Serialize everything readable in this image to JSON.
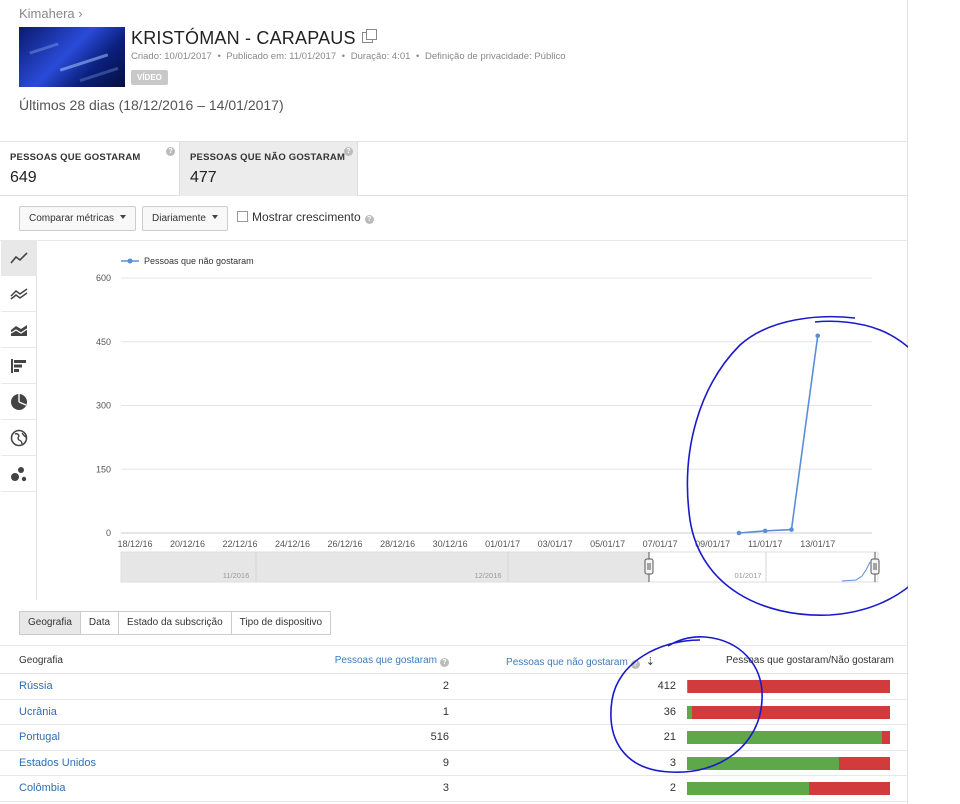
{
  "breadcrumb": "Kimahera ›",
  "video": {
    "title": "KRISTÓMAN - CARAPAUS",
    "created": "Criado: 10/01/2017",
    "published": "Publicado em: 11/01/2017",
    "duration": "Duração: 4:01",
    "privacy": "Definição de privacidade: Público",
    "badge": "VÍDEO",
    "separator": "•"
  },
  "date_range": "Últimos 28 dias (18/12/2016 – 14/01/2017)",
  "metrics": [
    {
      "label": "PESSOAS QUE GOSTARAM",
      "value": "649",
      "active": false
    },
    {
      "label": "PESSOAS QUE NÃO GOSTARAM",
      "value": "477",
      "active": true
    }
  ],
  "controls": {
    "compare_label": "Comparar métricas",
    "interval_label": "Diariamente",
    "growth_label": "Mostrar crescimento"
  },
  "chart_data": {
    "type": "line",
    "legend_position": "top-left",
    "grid": true,
    "series": [
      {
        "name": "Pessoas que não gostaram",
        "color": "#5b8ed6",
        "x": [
          "10/01/17",
          "11/01/17",
          "12/01/17",
          "13/01/17"
        ],
        "values": [
          0,
          5,
          8,
          464
        ]
      }
    ],
    "x_ticks": [
      "18/12/16",
      "20/12/16",
      "22/12/16",
      "24/12/16",
      "26/12/16",
      "28/12/16",
      "30/12/16",
      "01/01/17",
      "03/01/17",
      "05/01/17",
      "07/01/17",
      "09/01/17",
      "11/01/17",
      "13/01/17"
    ],
    "y_ticks": [
      "0",
      "150",
      "300",
      "450",
      "600"
    ],
    "ylim": [
      0,
      600
    ],
    "navigator_labels": [
      "11/2016",
      "12/2016",
      "01/2017"
    ]
  },
  "tabs": [
    {
      "label": "Geografia",
      "active": true
    },
    {
      "label": "Data",
      "active": false
    },
    {
      "label": "Estado da subscrição",
      "active": false
    },
    {
      "label": "Tipo de dispositivo",
      "active": false
    }
  ],
  "table": {
    "headers": {
      "geo": "Geografia",
      "likes": "Pessoas que gostaram",
      "dislikes": "Pessoas que não gostaram",
      "ratio": "Pessoas que gostaram/Não gostaram"
    },
    "rows": [
      {
        "geo": "Rússia",
        "likes": "2",
        "dislikes": "412",
        "like_share": 0.005
      },
      {
        "geo": "Ucrânia",
        "likes": "1",
        "dislikes": "36",
        "like_share": 0.027
      },
      {
        "geo": "Portugal",
        "likes": "516",
        "dislikes": "21",
        "like_share": 0.961
      },
      {
        "geo": "Estados Unidos",
        "likes": "9",
        "dislikes": "3",
        "like_share": 0.75
      },
      {
        "geo": "Colômbia",
        "likes": "3",
        "dislikes": "2",
        "like_share": 0.6
      }
    ]
  },
  "colors": {
    "like": "#5ea84a",
    "dislike": "#d23b3b",
    "series": "#5b8ed6",
    "annotation": "#1a1acc",
    "link": "#2f6eb5"
  },
  "icons": [
    "line-chart-icon",
    "compare-chart-icon",
    "area-chart-icon",
    "bar-chart-icon",
    "pie-chart-icon",
    "globe-icon",
    "bubble-chart-icon"
  ]
}
